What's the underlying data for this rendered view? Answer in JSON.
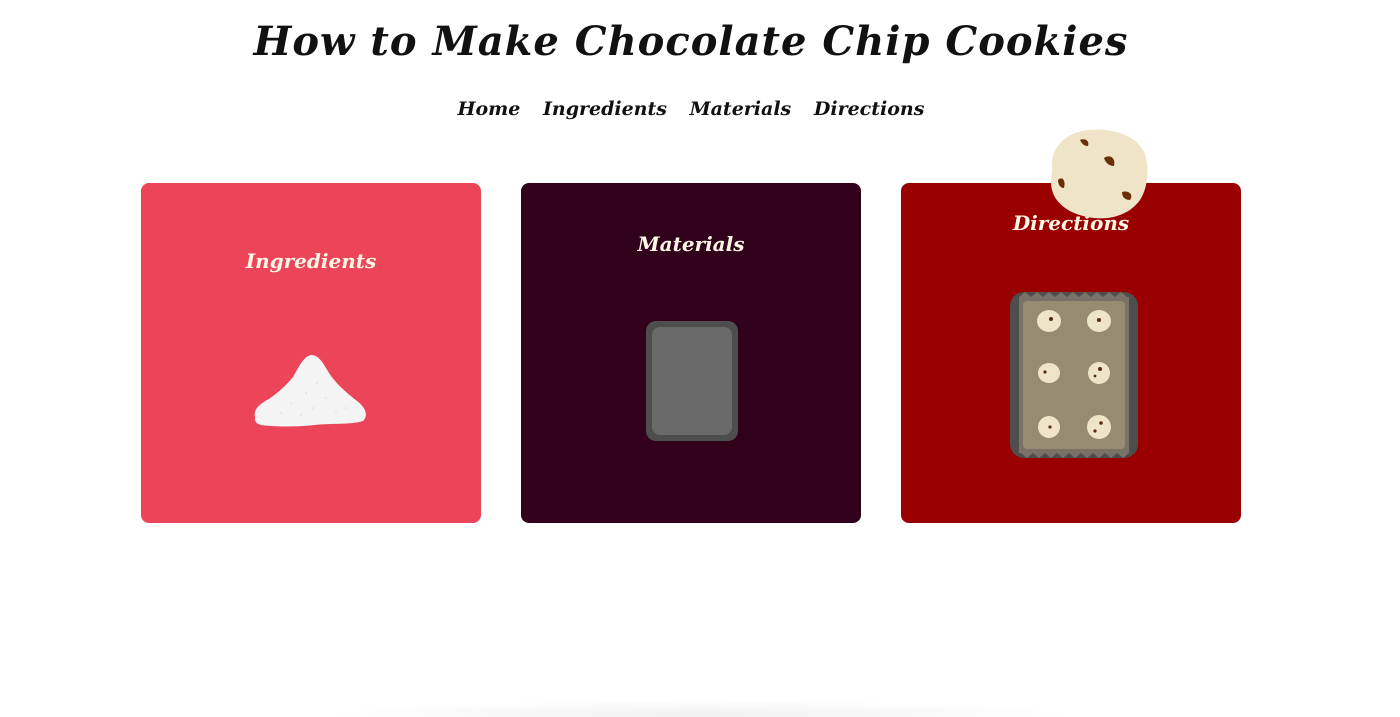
{
  "header": {
    "title": "How to Make Chocolate Chip Cookies"
  },
  "nav": {
    "items": [
      {
        "label": "Home"
      },
      {
        "label": "Ingredients"
      },
      {
        "label": "Materials"
      },
      {
        "label": "Directions"
      }
    ]
  },
  "cards": [
    {
      "title": "Ingredients",
      "color": "#ec455a",
      "icon": "flour-pile-icon"
    },
    {
      "title": "Materials",
      "color": "#31001a",
      "icon": "baking-tray-icon"
    },
    {
      "title": "Directions",
      "color": "#9b0000",
      "icon": "cookie-sheet-icon"
    }
  ],
  "decor": {
    "cookie_dough_icon": "cookie-dough-icon",
    "dough_color": "#efe4c8",
    "chip_color": "#6b2e0a"
  }
}
